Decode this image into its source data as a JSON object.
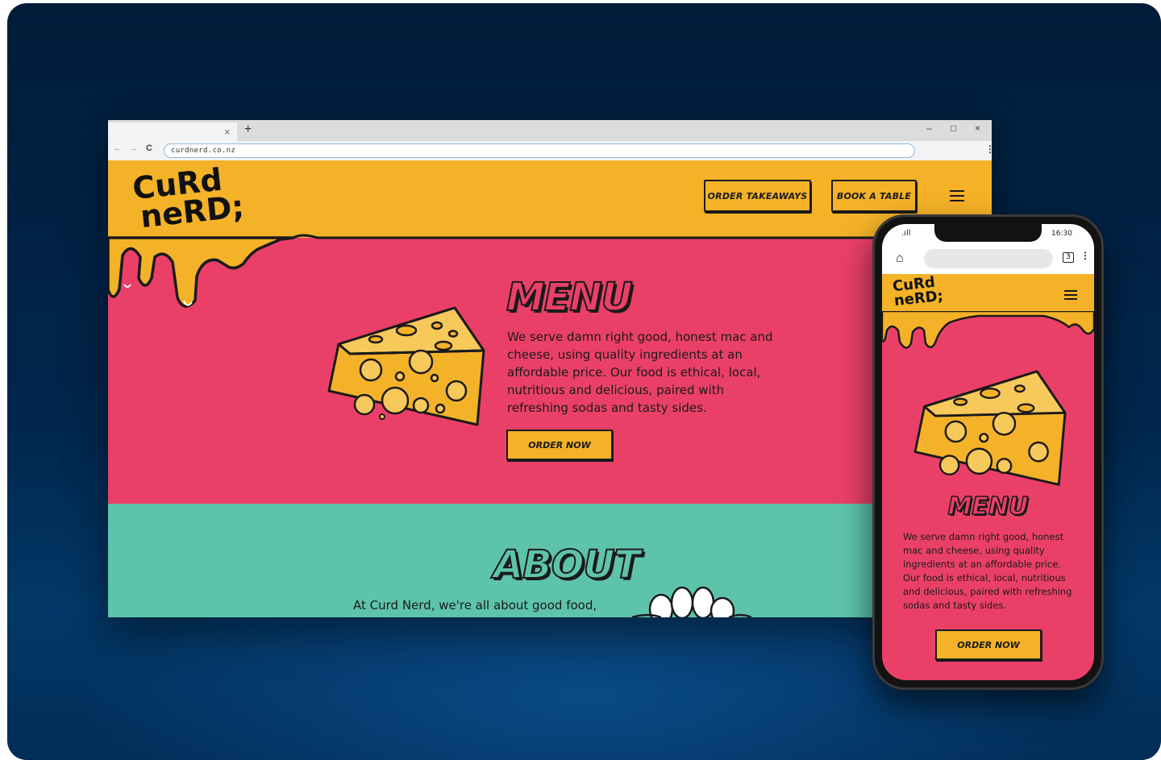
{
  "browser": {
    "url": "curdnerd.co.nz",
    "tab_close": "×",
    "new_tab": "+",
    "minimize": "–",
    "maximize": "□",
    "close": "×",
    "back": "←",
    "forward": "→",
    "reload": "C",
    "menu": "⋮"
  },
  "site": {
    "logo_line1": "CuRd",
    "logo_line2": "neRD;",
    "order_takeaways": "ORDER TAKEAWAYS",
    "book_table": "BOOK A TABLE",
    "menu_title": "MENU",
    "menu_text": "We serve damn right good, honest mac and cheese, using quality ingredients at an affordable price. Our food is ethical, local, nutritious and delicious, paired with refreshing sodas and tasty sides.",
    "order_now": "ORDER NOW",
    "about_title": "ABOUT",
    "about_text": "At Curd Nerd, we're all about  good food,"
  },
  "phone": {
    "signal": ".ıll",
    "time": "16:30",
    "tabs_count": "3",
    "kebab": "⋮",
    "home_icon": "⌂",
    "logo_line1": "CuRd",
    "logo_line2": "neRD;",
    "menu_title": "MENU",
    "menu_text": "We serve damn right good, honest mac and cheese, using quality ingredients at an affordable price. Our food is ethical, local, nutritious and delicious, paired with refreshing sodas and tasty sides.",
    "order_now": "ORDER NOW"
  },
  "colors": {
    "yellow": "#f4b228",
    "pink": "#ea4068",
    "teal": "#5ec3ab",
    "navy": "#01264c"
  }
}
